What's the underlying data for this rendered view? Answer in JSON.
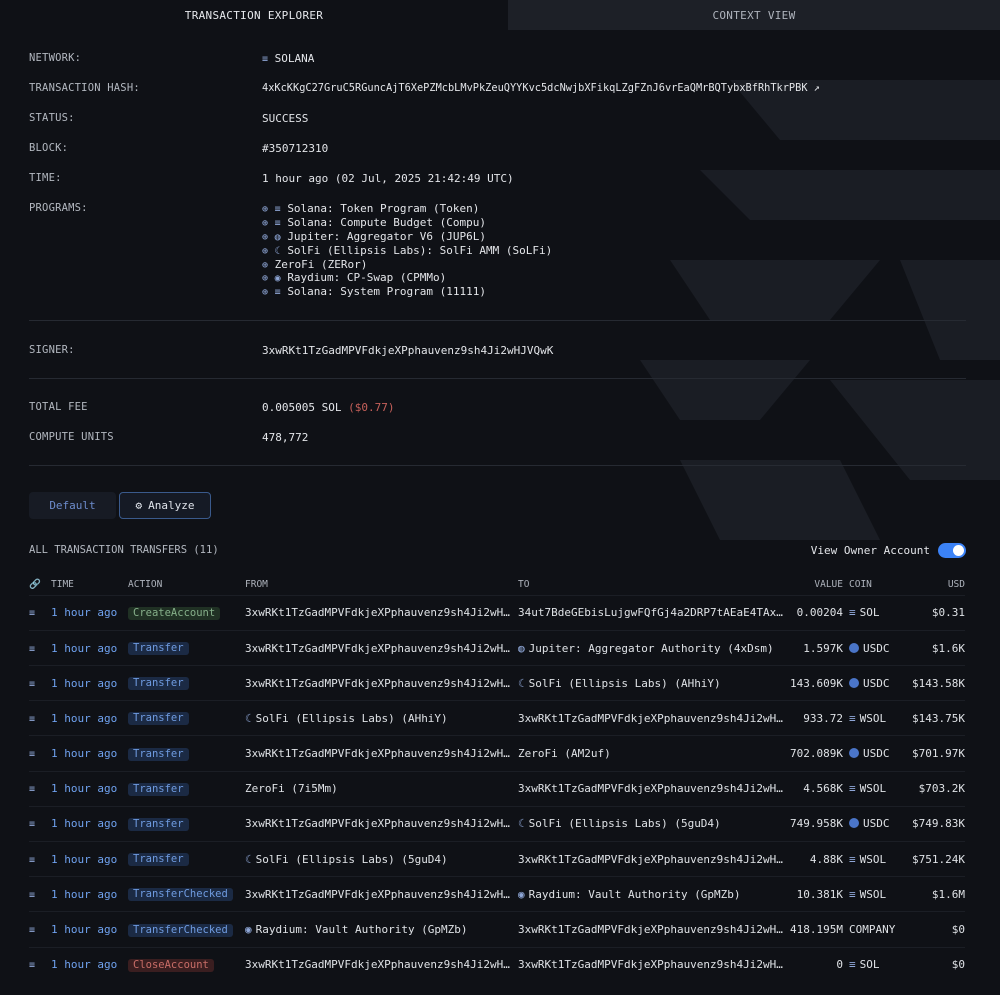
{
  "tabs": [
    "TRANSACTION EXPLORER",
    "CONTEXT VIEW"
  ],
  "details": {
    "network_label": "NETWORK:",
    "network": "SOLANA",
    "hash_label": "TRANSACTION HASH:",
    "hash": "4xKcKKgC27GruC5RGuncAjT6XePZMcbLMvPkZeuQYYKvc5dcNwjbXFikqLZgFZnJ6vrEaQMrBQTybxBfRhTkrPBK",
    "status_label": "STATUS:",
    "status": "SUCCESS",
    "block_label": "BLOCK:",
    "block": "#350712310",
    "time_label": "TIME:",
    "time": "1 hour ago  (02 Jul, 2025 21:42:49 UTC)",
    "programs_label": "PROGRAMS:",
    "programs": [
      "Solana: Token Program (Token)",
      "Solana: Compute Budget (Compu)",
      "Jupiter: Aggregator V6 (JUP6L)",
      "SolFi (Ellipsis Labs): SolFi AMM (SoLFi)",
      "ZeroFi (ZERor)",
      "Raydium: CP-Swap (CPMMo)",
      "Solana: System Program (11111)"
    ],
    "signer_label": "SIGNER:",
    "signer": "3xwRKt1TzGadMPVFdkjeXPphauvenz9sh4Ji2wHJVQwK",
    "fee_label": "TOTAL FEE",
    "fee": "0.005005 SOL",
    "fee_usd": "($0.77)",
    "cu_label": "COMPUTE UNITS",
    "cu": "478,772"
  },
  "buttons": {
    "default": "Default",
    "analyze": "Analyze"
  },
  "transfers": {
    "title": "ALL TRANSACTION TRANSFERS (11)",
    "toggle_label": "View Owner Account",
    "columns": [
      "TIME",
      "ACTION",
      "FROM",
      "TO",
      "VALUE",
      "COIN",
      "USD"
    ],
    "rows": [
      {
        "time": "1 hour ago",
        "action": "CreateAccount",
        "from": "3xwRKt1TzGadMPVFdkjeXPphauvenz9sh4Ji2wH…",
        "to": "34ut7BdeGEbisLujgwFQfGj4a2DRP7tAEaE4TAx…",
        "value": "0.00204",
        "coin": "SOL",
        "usd": "$0.31"
      },
      {
        "time": "1 hour ago",
        "action": "Transfer",
        "from": "3xwRKt1TzGadMPVFdkjeXPphauvenz9sh4Ji2wH…",
        "to": "Jupiter: Aggregator Authority (4xDsm)",
        "value": "1.597K",
        "coin": "USDC",
        "usd": "$1.6K"
      },
      {
        "time": "1 hour ago",
        "action": "Transfer",
        "from": "3xwRKt1TzGadMPVFdkjeXPphauvenz9sh4Ji2wH…",
        "to": "SolFi (Ellipsis Labs) (AHhiY)",
        "value": "143.609K",
        "coin": "USDC",
        "usd": "$143.58K"
      },
      {
        "time": "1 hour ago",
        "action": "Transfer",
        "from": "SolFi (Ellipsis Labs) (AHhiY)",
        "to": "3xwRKt1TzGadMPVFdkjeXPphauvenz9sh4Ji2wH…",
        "value": "933.72",
        "coin": "WSOL",
        "usd": "$143.75K"
      },
      {
        "time": "1 hour ago",
        "action": "Transfer",
        "from": "3xwRKt1TzGadMPVFdkjeXPphauvenz9sh4Ji2wH…",
        "to": "ZeroFi (AM2uf)",
        "value": "702.089K",
        "coin": "USDC",
        "usd": "$701.97K"
      },
      {
        "time": "1 hour ago",
        "action": "Transfer",
        "from": "ZeroFi (7i5Mm)",
        "to": "3xwRKt1TzGadMPVFdkjeXPphauvenz9sh4Ji2wH…",
        "value": "4.568K",
        "coin": "WSOL",
        "usd": "$703.2K"
      },
      {
        "time": "1 hour ago",
        "action": "Transfer",
        "from": "3xwRKt1TzGadMPVFdkjeXPphauvenz9sh4Ji2wH…",
        "to": "SolFi (Ellipsis Labs) (5guD4)",
        "value": "749.958K",
        "coin": "USDC",
        "usd": "$749.83K"
      },
      {
        "time": "1 hour ago",
        "action": "Transfer",
        "from": "SolFi (Ellipsis Labs) (5guD4)",
        "to": "3xwRKt1TzGadMPVFdkjeXPphauvenz9sh4Ji2wH…",
        "value": "4.88K",
        "coin": "WSOL",
        "usd": "$751.24K"
      },
      {
        "time": "1 hour ago",
        "action": "TransferChecked",
        "from": "3xwRKt1TzGadMPVFdkjeXPphauvenz9sh4Ji2wH…",
        "to": "Raydium: Vault Authority (GpMZb)",
        "value": "10.381K",
        "coin": "WSOL",
        "usd": "$1.6M"
      },
      {
        "time": "1 hour ago",
        "action": "TransferChecked",
        "from": "Raydium: Vault Authority (GpMZb)",
        "to": "3xwRKt1TzGadMPVFdkjeXPphauvenz9sh4Ji2wH…",
        "value": "418.195M",
        "coin": "COMPANY",
        "usd": "$0"
      },
      {
        "time": "1 hour ago",
        "action": "CloseAccount",
        "from": "3xwRKt1TzGadMPVFdkjeXPphauvenz9sh4Ji2wH…",
        "to": "3xwRKt1TzGadMPVFdkjeXPphauvenz9sh4Ji2wH…",
        "value": "0",
        "coin": "SOL",
        "usd": "$0"
      }
    ]
  }
}
